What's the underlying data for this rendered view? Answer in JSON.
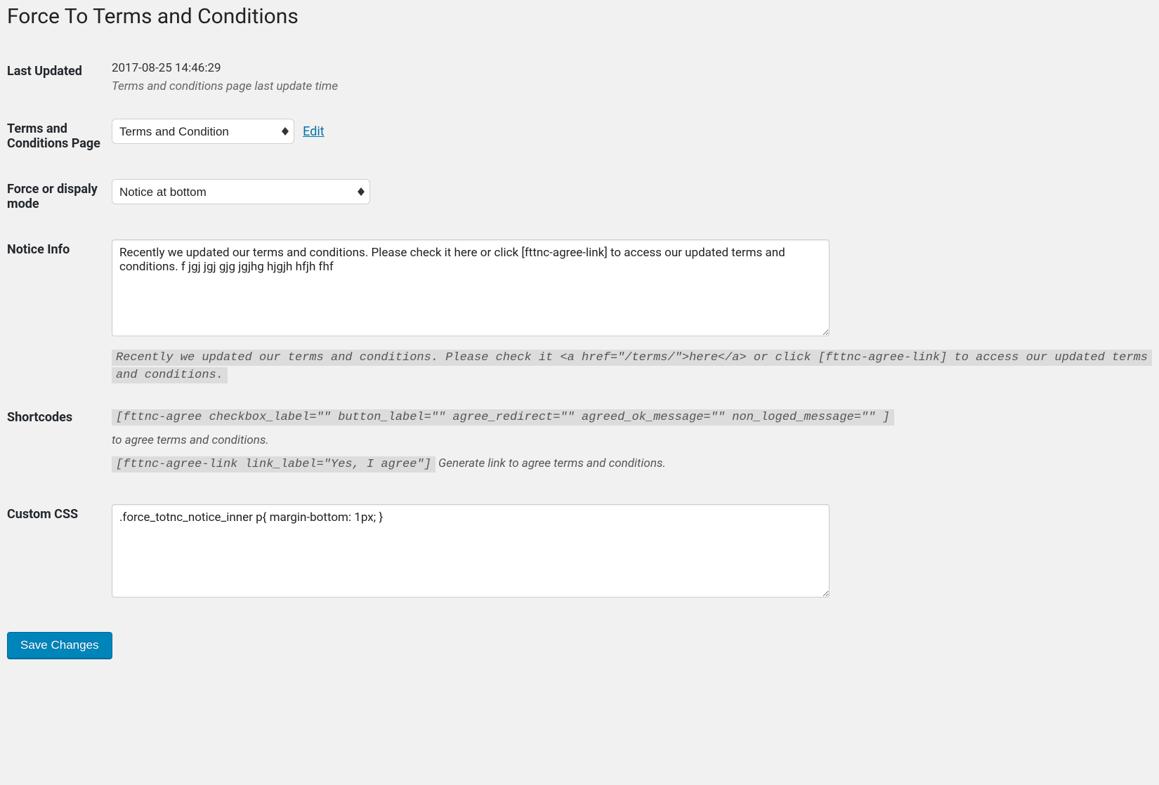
{
  "page_title": "Force To Terms and Conditions",
  "rows": {
    "last_updated": {
      "label": "Last Updated",
      "value": "2017-08-25 14:46:29",
      "desc": "Terms and conditions page last update time"
    },
    "tc_page": {
      "label": "Terms and Conditions Page",
      "selected": "Terms and Condition",
      "edit_link": "Edit"
    },
    "mode": {
      "label": "Force or dispaly mode",
      "selected": "Notice at bottom"
    },
    "notice_info": {
      "label": "Notice Info",
      "value": "Recently we updated our terms and conditions. Please check it here or click [fttnc-agree-link] to access our updated terms and conditions. f jgj jgj gjg jgjhg hjgjh hfjh fhf",
      "hint_code": "Recently we updated our terms and conditions. Please check it <a href=\"/terms/\">here</a> or click [fttnc-agree-link] to access our updated terms",
      "hint_tail": "and conditions."
    },
    "shortcodes": {
      "label": "Shortcodes",
      "line1_code": "[fttnc-agree checkbox_label=\"\" button_label=\"\" agree_redirect=\"\" agreed_ok_message=\"\" non_loged_message=\"\" ]",
      "line1_text": "to agree terms and conditions.",
      "line2_code": "[fttnc-agree-link link_label=\"Yes, I agree\"]",
      "line2_text": " Generate link to agree terms and conditions."
    },
    "custom_css": {
      "label": "Custom CSS",
      "value": ".force_totnc_notice_inner p{ margin-bottom: 1px; }"
    }
  },
  "save_button": "Save Changes"
}
